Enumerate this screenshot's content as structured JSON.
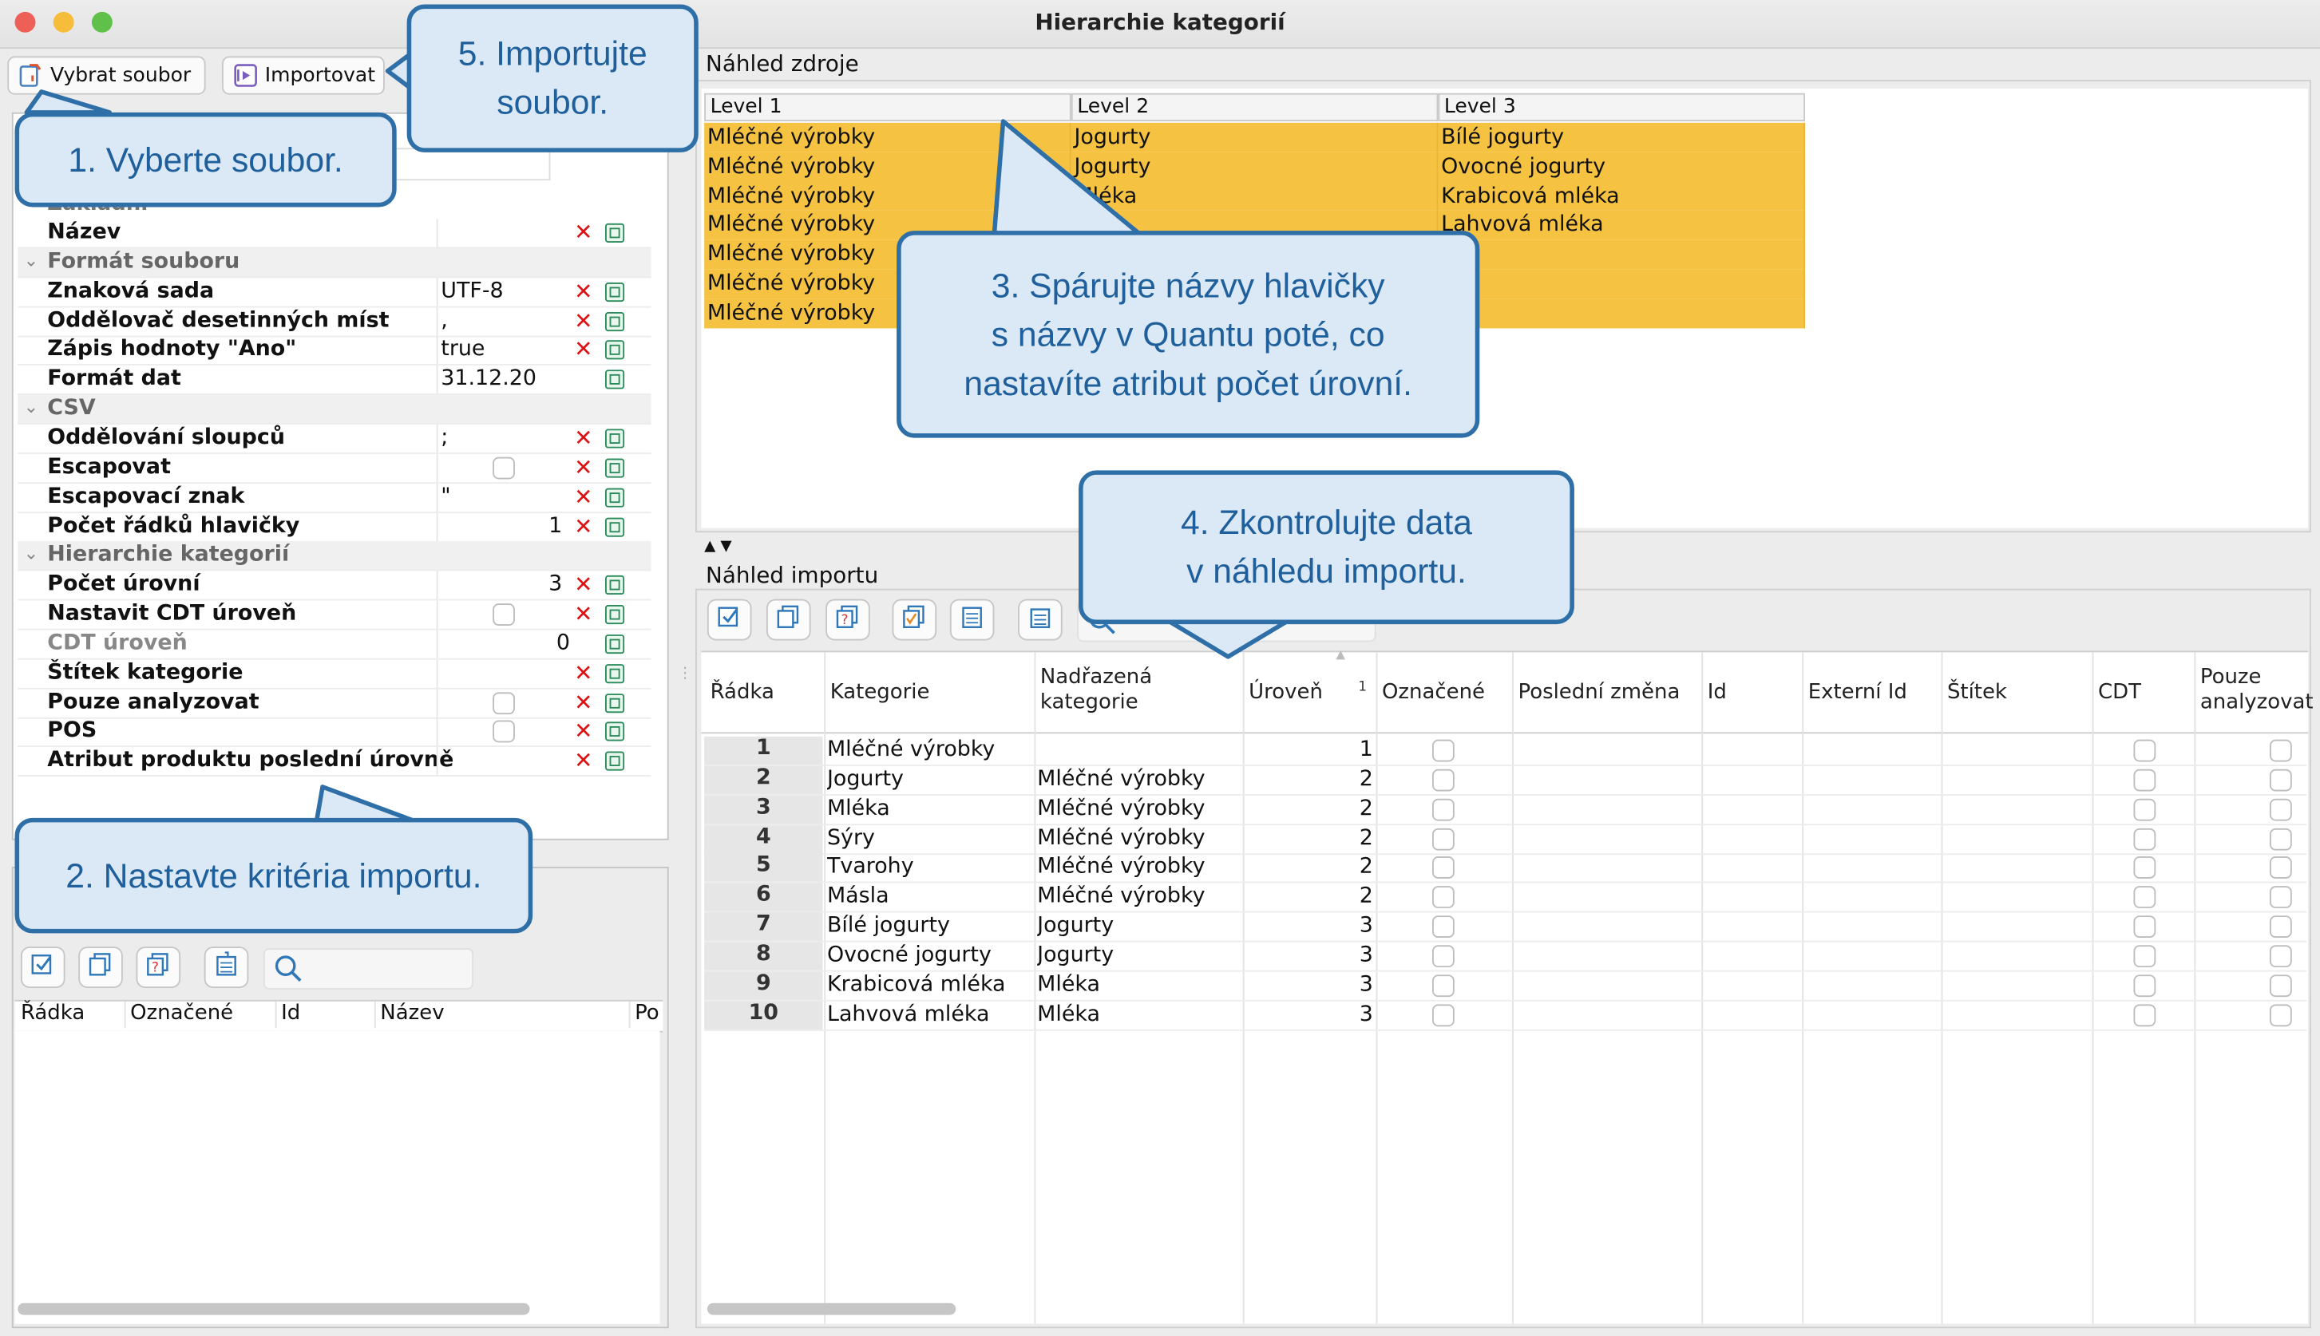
{
  "window": {
    "title": "Hierarchie kategorií"
  },
  "toolbar": {
    "select_file": "Vybrat soubor",
    "import": "Importovat"
  },
  "properties": {
    "partial_header": "Základní",
    "rows": [
      {
        "type": "prop",
        "label": "Název",
        "value": "",
        "checkbox": false,
        "x": true,
        "copy": true
      },
      {
        "type": "cat",
        "label": "Formát souboru"
      },
      {
        "type": "prop",
        "label": "Znaková sada",
        "value": "UTF-8",
        "x": true,
        "copy": true
      },
      {
        "type": "prop",
        "label": "Oddělovač desetinných míst",
        "value": ",",
        "x": true,
        "copy": true
      },
      {
        "type": "prop",
        "label": "Zápis hodnoty \"Ano\"",
        "value": "true",
        "x": true,
        "copy": true
      },
      {
        "type": "prop",
        "label": "Formát dat",
        "value": "31.12.20",
        "x": false,
        "copy": true
      },
      {
        "type": "cat",
        "label": "CSV"
      },
      {
        "type": "prop",
        "label": "Oddělování sloupců",
        "value": ";",
        "x": true,
        "copy": true
      },
      {
        "type": "prop",
        "label": "Escapovat",
        "value": "",
        "checkbox": true,
        "x": true,
        "copy": true
      },
      {
        "type": "prop",
        "label": "Escapovací znak",
        "value": "\"",
        "x": true,
        "copy": true
      },
      {
        "type": "prop",
        "label": "Počet řádků hlavičky",
        "value": "1",
        "align": "right",
        "x": true,
        "copy": true
      },
      {
        "type": "cat",
        "label": "Hierarchie kategorií"
      },
      {
        "type": "prop",
        "label": "Počet úrovní",
        "value": "3",
        "align": "right",
        "x": true,
        "copy": true
      },
      {
        "type": "prop",
        "label": "Nastavit CDT úroveň",
        "value": "",
        "checkbox": true,
        "x": true,
        "copy": true
      },
      {
        "type": "prop",
        "label": "CDT úroveň",
        "value": "0",
        "align": "mid",
        "dim": true,
        "x": false,
        "copy": true
      },
      {
        "type": "prop",
        "label": "Štítek kategorie",
        "value": "",
        "x": true,
        "copy": true
      },
      {
        "type": "prop",
        "label": "Pouze analyzovat",
        "value": "",
        "checkbox": true,
        "x": true,
        "copy": true
      },
      {
        "type": "prop",
        "label": "POS",
        "value": "",
        "checkbox": true,
        "x": true,
        "copy": true
      },
      {
        "type": "prop",
        "label": "Atribut produktu poslední úrovně",
        "value": "",
        "x": true,
        "copy": true
      }
    ]
  },
  "left_table": {
    "headers": [
      "Řádka",
      "Označené",
      "Id",
      "Název",
      "Po"
    ]
  },
  "source_preview": {
    "title": "Náhled zdroje",
    "headers": [
      "Level 1",
      "Level 2",
      "Level 3"
    ],
    "rows": [
      [
        "Mléčné výrobky",
        "Jogurty",
        "Bílé jogurty"
      ],
      [
        "Mléčné výrobky",
        "Jogurty",
        "Ovocné jogurty"
      ],
      [
        "Mléčné výrobky",
        "Mléka",
        "Krabicová mléka"
      ],
      [
        "Mléčné výrobky",
        "",
        "Lahvová mléka"
      ],
      [
        "Mléčné výrobky",
        "",
        ""
      ],
      [
        "Mléčné výrobky",
        "",
        ""
      ],
      [
        "Mléčné výrobky",
        "",
        ""
      ]
    ],
    "highlight_color": "#f5c242"
  },
  "import_preview": {
    "title": "Náhled importu",
    "headers": [
      "Řádka",
      "Kategorie",
      "Nadřazená kategorie",
      "Úroveň",
      "Označené",
      "Poslední změna",
      "Id",
      "Externí Id",
      "Štítek",
      "CDT",
      "Pouze analyzovat"
    ],
    "sort_indicator": "1",
    "rows": [
      {
        "n": "1",
        "kategorie": "Mléčné výrobky",
        "nadrazena": "",
        "uroven": "1"
      },
      {
        "n": "2",
        "kategorie": "Jogurty",
        "nadrazena": "Mléčné výrobky",
        "uroven": "2"
      },
      {
        "n": "3",
        "kategorie": "Mléka",
        "nadrazena": "Mléčné výrobky",
        "uroven": "2"
      },
      {
        "n": "4",
        "kategorie": "Sýry",
        "nadrazena": "Mléčné výrobky",
        "uroven": "2"
      },
      {
        "n": "5",
        "kategorie": "Tvarohy",
        "nadrazena": "Mléčné výrobky",
        "uroven": "2"
      },
      {
        "n": "6",
        "kategorie": "Másla",
        "nadrazena": "Mléčné výrobky",
        "uroven": "2"
      },
      {
        "n": "7",
        "kategorie": "Bílé jogurty",
        "nadrazena": "Jogurty",
        "uroven": "3"
      },
      {
        "n": "8",
        "kategorie": "Ovocné jogurty",
        "nadrazena": "Jogurty",
        "uroven": "3"
      },
      {
        "n": "9",
        "kategorie": "Krabicová mléka",
        "nadrazena": "Mléka",
        "uroven": "3"
      },
      {
        "n": "10",
        "kategorie": "Lahvová mléka",
        "nadrazena": "Mléka",
        "uroven": "3"
      }
    ]
  },
  "callouts": {
    "c1": "1. Vyberte soubor.",
    "c2": "2. Nastavte kritéria importu.",
    "c3": "3. Spárujte názvy hlavičky\ns názvy v Quantu poté, co\nnastavíte atribut počet úrovní.",
    "c4": "4. Zkontrolujte data\nv náhledu importu.",
    "c5": "5. Importujte\nsoubor."
  },
  "colors": {
    "callout_border": "#2f6fa8",
    "callout_fill": "#dbe9f6",
    "callout_text": "#1e5f9c",
    "delete_x": "#d11111"
  }
}
